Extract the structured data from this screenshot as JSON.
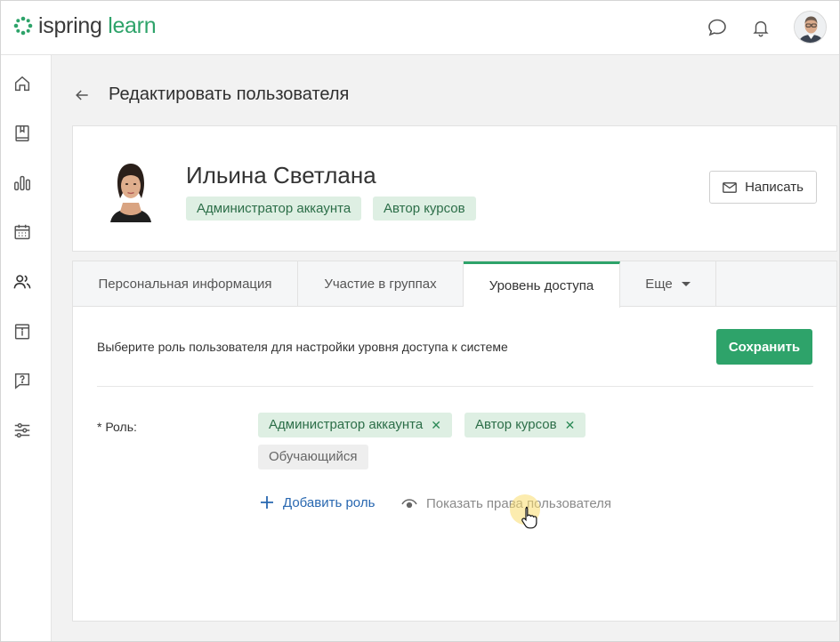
{
  "app": {
    "logo_part1": "ispring",
    "logo_part2": "learn",
    "colors": {
      "brand": "#2ea36a",
      "link": "#2867b0",
      "chip_bg": "#deefe3"
    }
  },
  "topbar": {
    "icons": [
      "chat-icon",
      "bell-icon",
      "user-avatar"
    ]
  },
  "sidebar": {
    "items": [
      "home-icon",
      "courses-icon",
      "reports-icon",
      "calendar-icon",
      "users-icon",
      "info-icon",
      "help-icon",
      "settings-icon"
    ]
  },
  "page": {
    "title": "Редактировать пользователя"
  },
  "profile": {
    "name": "Ильина Светлана",
    "roles": [
      "Администратор аккаунта",
      "Автор курсов"
    ],
    "write_button": "Написать"
  },
  "tabs": [
    {
      "label": "Персональная информация"
    },
    {
      "label": "Участие в группах"
    },
    {
      "label": "Уровень доступа"
    },
    {
      "label": "Еще"
    }
  ],
  "active_tab": "Уровень доступа",
  "access": {
    "description": "Выберите роль пользователя для настройки уровня доступа к системе",
    "save_button": "Сохранить",
    "role_label": "* Роль:",
    "assigned_roles": [
      "Администратор аккаунта",
      "Автор курсов"
    ],
    "available_roles": [
      "Обучающийся"
    ],
    "add_role": "Добавить роль",
    "show_rights": "Показать права пользователя"
  }
}
